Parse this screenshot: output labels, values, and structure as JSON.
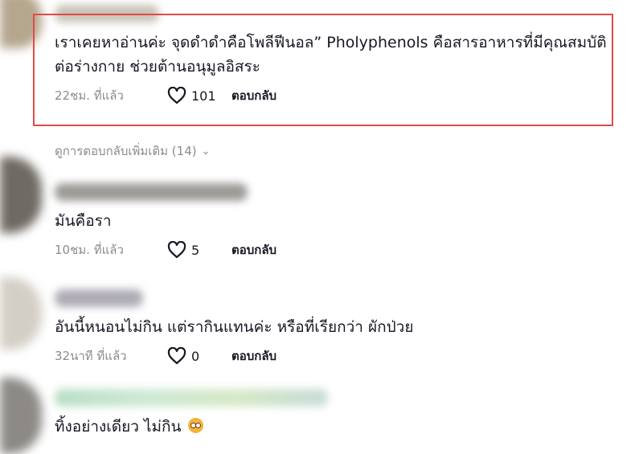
{
  "comments": [
    {
      "text": "เราเคยหาอ่านค่ะ จุดดำดำคือโพลีฟีนอล” Pholyphenols คือสารอาหารที่มีคุณสมบัติต่อร่างกาย ช่วยต้านอนุมูลอิสระ",
      "time": "22ชม. ที่แล้ว",
      "likes": "101",
      "reply": "ตอบกลับ",
      "more_replies": "ดูการตอบกลับเพิ่มเติม (14)"
    },
    {
      "text": "มันคือรา",
      "time": "10ชม. ที่แล้ว",
      "likes": "5",
      "reply": "ตอบกลับ"
    },
    {
      "text": "อันนี้หนอนไม่กิน แต่รากินแทนค่ะ หรือที่เรียกว่า ผักป่วย",
      "time": "32นาที ที่แล้ว",
      "likes": "0",
      "reply": "ตอบกลับ"
    },
    {
      "text": "ทิ้งอย่างเดียว ไม่กิน",
      "emoji": "flushed-face"
    }
  ],
  "colors": {
    "highlight_border": "#e24a4a",
    "secondary_text": "#8a8b91",
    "primary_text": "#161823"
  }
}
